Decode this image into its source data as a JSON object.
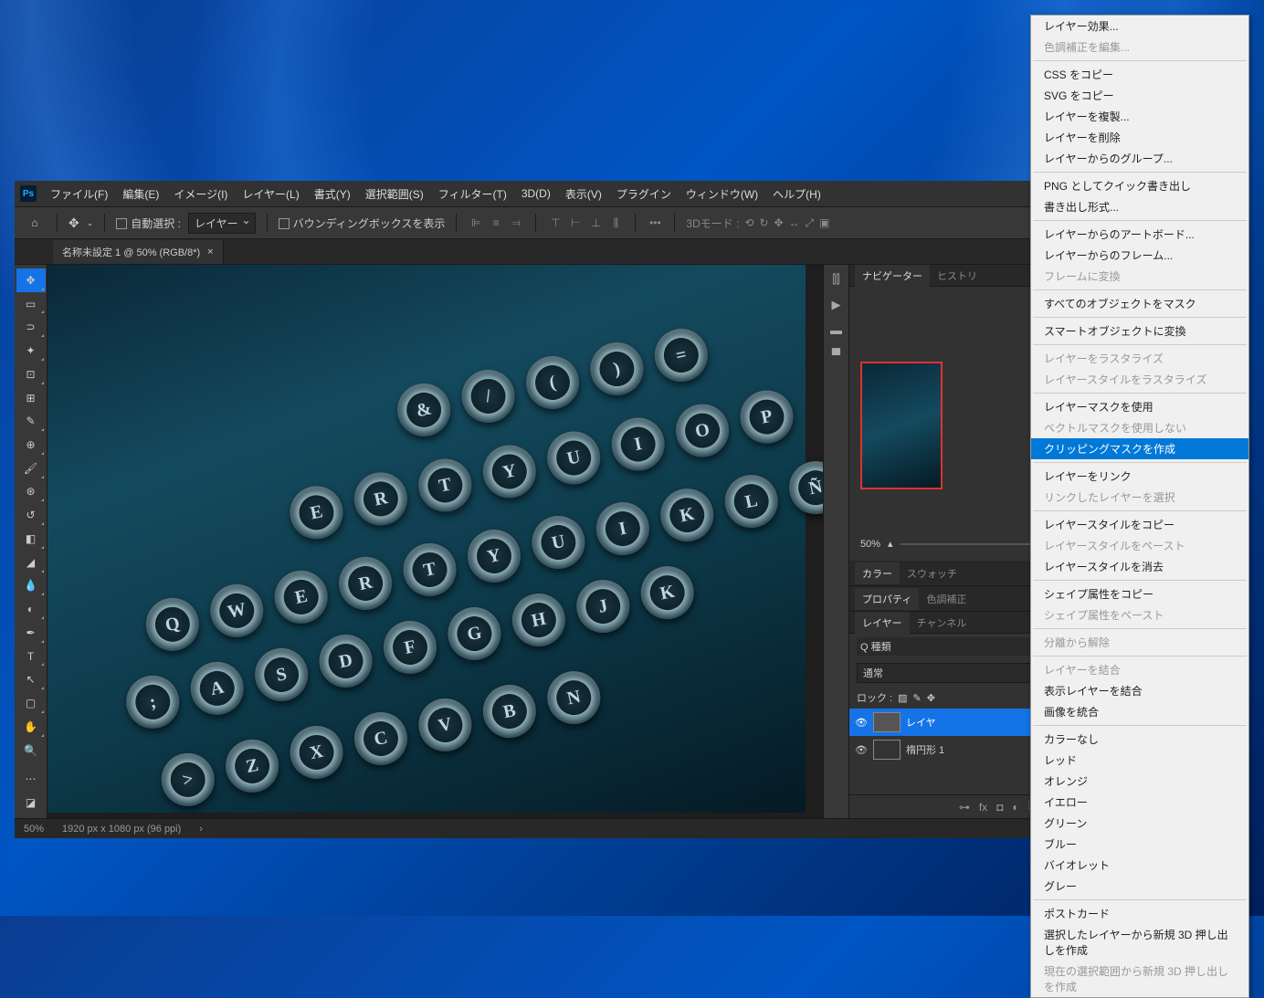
{
  "menubar": {
    "items": [
      "ファイル(F)",
      "編集(E)",
      "イメージ(I)",
      "レイヤー(L)",
      "書式(Y)",
      "選択範囲(S)",
      "フィルター(T)",
      "3D(D)",
      "表示(V)",
      "プラグイン",
      "ウィンドウ(W)",
      "ヘルプ(H)"
    ]
  },
  "optbar": {
    "auto_select": "自動選択 :",
    "layer_dd": "レイヤー",
    "bounding": "バウンディングボックスを表示",
    "mode3d_label": "3Dモード :"
  },
  "doc_tab": "名称未設定 1 @  50% (RGB/8*)",
  "navigator": {
    "tab1": "ナビゲーター",
    "tab2": "ヒストリ",
    "zoom": "50%"
  },
  "color_panel": {
    "tab1": "カラー",
    "tab2": "スウォッチ"
  },
  "props_panel": {
    "tab1": "プロパティ",
    "tab2": "色調補正"
  },
  "layers_panel": {
    "tab1": "レイヤー",
    "tab2": "チャンネル",
    "kind": "Q 種類",
    "blend": "通常",
    "lock": "ロック :",
    "layer1_name": "レイヤ",
    "layer2_name": "楕円形  1"
  },
  "statusbar": {
    "zoom": "50%",
    "dims": "1920 px x 1080 px (96 ppi)"
  },
  "context_menu": {
    "g1": [
      "レイヤー効果...",
      "色調補正を編集..."
    ],
    "g2": [
      "CSS をコピー",
      "SVG をコピー",
      "レイヤーを複製...",
      "レイヤーを削除",
      "レイヤーからのグループ..."
    ],
    "g3": [
      "PNG としてクイック書き出し",
      "書き出し形式..."
    ],
    "g4": [
      "レイヤーからのアートボード...",
      "レイヤーからのフレーム...",
      "フレームに変換"
    ],
    "g5": [
      "すべてのオブジェクトをマスク"
    ],
    "g6": [
      "スマートオブジェクトに変換"
    ],
    "g7": [
      "レイヤーをラスタライズ",
      "レイヤースタイルをラスタライズ"
    ],
    "g8": [
      "レイヤーマスクを使用",
      "ベクトルマスクを使用しない",
      "クリッピングマスクを作成"
    ],
    "g9": [
      "レイヤーをリンク",
      "リンクしたレイヤーを選択"
    ],
    "g10": [
      "レイヤースタイルをコピー",
      "レイヤースタイルをペースト",
      "レイヤースタイルを消去"
    ],
    "g11": [
      "シェイプ属性をコピー",
      "シェイプ属性をペースト"
    ],
    "g12": [
      "分離から解除"
    ],
    "g13": [
      "レイヤーを結合",
      "表示レイヤーを結合",
      "画像を統合"
    ],
    "g14": [
      "カラーなし",
      "レッド",
      "オレンジ",
      "イエロー",
      "グリーン",
      "ブルー",
      "バイオレット",
      "グレー"
    ],
    "g15": [
      "ポストカード",
      "選択したレイヤーから新規 3D 押し出しを作成",
      "現在の選択範囲から新規 3D 押し出しを作成"
    ]
  }
}
